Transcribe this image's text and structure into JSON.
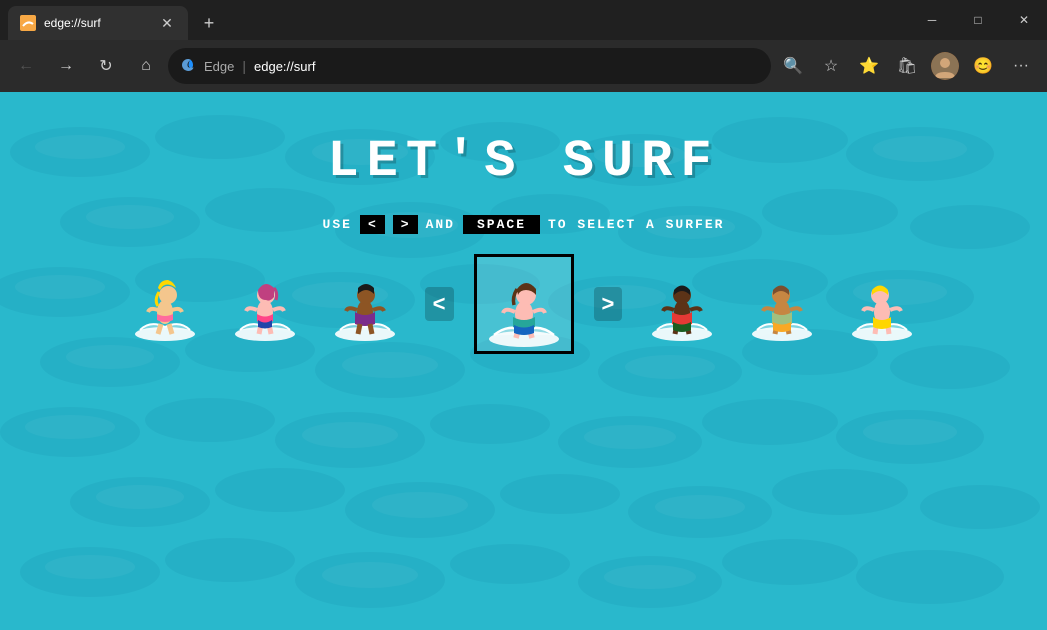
{
  "titlebar": {
    "tab": {
      "favicon": "🌊",
      "title": "edge://surf",
      "close_label": "✕"
    },
    "new_tab_label": "+",
    "controls": {
      "minimize": "─",
      "maximize": "□",
      "close": "✕"
    }
  },
  "navbar": {
    "back_label": "←",
    "forward_label": "→",
    "refresh_label": "↻",
    "home_label": "⌂",
    "edge_logo": "e",
    "edge_label": "Edge",
    "separator": "|",
    "address": "edge://surf",
    "search_icon": "🔍",
    "favorites_icon": "☆",
    "collections_icon": "★",
    "wallet_icon": "🛍",
    "profile_icon": "👤",
    "emoji_icon": "😊",
    "more_icon": "···"
  },
  "game": {
    "title": "LET'S  SURF",
    "instruction_prefix": "USE",
    "key_left": "<",
    "key_right": ">",
    "instruction_middle": "AND",
    "key_space": "SPACE",
    "instruction_suffix": "TO SELECT A SURFER",
    "nav_left": "<",
    "nav_right": ">",
    "surfers": [
      {
        "id": "surfer1",
        "label": "Blonde girl surfer",
        "selected": false
      },
      {
        "id": "surfer2",
        "label": "Pink top girl surfer",
        "selected": false
      },
      {
        "id": "surfer3",
        "label": "Purple shirt surfer",
        "selected": false
      },
      {
        "id": "surfer4",
        "label": "Teal shirt girl surfer",
        "selected": true
      },
      {
        "id": "surfer5",
        "label": "Dark skin boy surfer",
        "selected": false
      },
      {
        "id": "surfer6",
        "label": "Tan shirt boy surfer",
        "selected": false
      },
      {
        "id": "surfer7",
        "label": "Yellow swim trunks surfer",
        "selected": false
      }
    ]
  }
}
